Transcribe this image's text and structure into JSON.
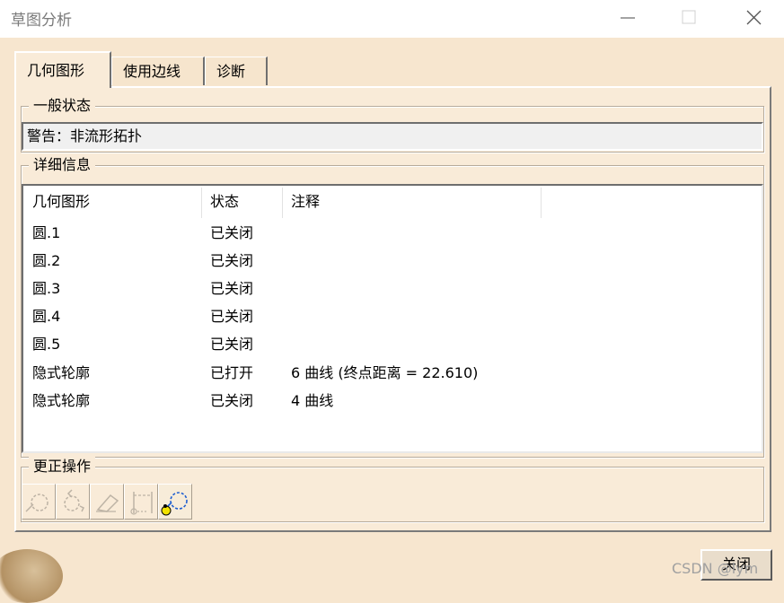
{
  "window": {
    "title": "草图分析"
  },
  "tabs": [
    {
      "label": "几何图形",
      "active": true
    },
    {
      "label": "使用边线",
      "active": false
    },
    {
      "label": "诊断",
      "active": false
    }
  ],
  "general_status": {
    "label": "一般状态",
    "message": "警告：非流形拓扑"
  },
  "details": {
    "label": "详细信息",
    "columns": [
      "几何图形",
      "状态",
      "注释"
    ],
    "rows": [
      {
        "geometry": "圆.1",
        "status": "已关闭",
        "note": ""
      },
      {
        "geometry": "圆.2",
        "status": "已关闭",
        "note": ""
      },
      {
        "geometry": "圆.3",
        "status": "已关闭",
        "note": ""
      },
      {
        "geometry": "圆.4",
        "status": "已关闭",
        "note": ""
      },
      {
        "geometry": "圆.5",
        "status": "已关闭",
        "note": ""
      },
      {
        "geometry": "隐式轮廓",
        "status": "已打开",
        "note": "6 曲线 (终点距离 = 22.610)"
      },
      {
        "geometry": "隐式轮廓",
        "status": "已关闭",
        "note": "4 曲线"
      }
    ]
  },
  "corrective_actions": {
    "label": "更正操作",
    "tools": [
      {
        "icon": "dashed-circle-icon",
        "enabled": false
      },
      {
        "icon": "rotate-circle-icon",
        "enabled": false
      },
      {
        "icon": "eraser-icon",
        "enabled": false
      },
      {
        "icon": "construction-element-icon",
        "enabled": false
      },
      {
        "icon": "highlight-geometry-icon",
        "enabled": true
      }
    ]
  },
  "close_button": {
    "label": "关闭"
  },
  "watermark": "CSDN @lym"
}
